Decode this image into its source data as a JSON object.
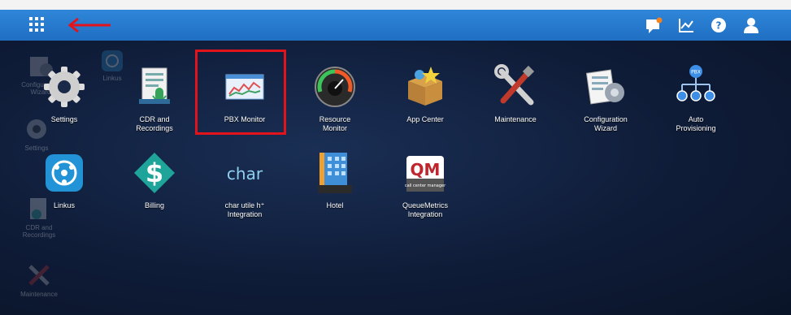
{
  "topbar": {
    "left_icon": "apps-grid-icon",
    "annotation": "red-arrow-icon",
    "right_icons": [
      "notification-icon",
      "chart-icon",
      "help-icon",
      "user-icon"
    ],
    "colors": {
      "bar": "#2377cd",
      "badge": "#f5821f"
    }
  },
  "background_items": [
    {
      "label": "Configuration\nWizard",
      "icon": "config-wizard-icon"
    },
    {
      "label": "Linkus",
      "icon": "linkus-icon"
    },
    {
      "label": "Settings",
      "icon": "gear-icon"
    },
    {
      "label": "CDR and\nRecordings",
      "icon": "cdr-icon"
    },
    {
      "label": "Maintenance",
      "icon": "tools-icon"
    }
  ],
  "apps": [
    {
      "label": "Settings",
      "icon": "gear-icon"
    },
    {
      "label": "CDR and\nRecordings",
      "icon": "cdr-icon"
    },
    {
      "label": "PBX Monitor",
      "icon": "monitor-icon"
    },
    {
      "label": "Resource\nMonitor",
      "icon": "gauge-icon"
    },
    {
      "label": "App Center",
      "icon": "box-icon"
    },
    {
      "label": "Maintenance",
      "icon": "tools-icon"
    },
    {
      "label": "Configuration\nWizard",
      "icon": "config-wizard-icon"
    },
    {
      "label": "Auto\nProvisioning",
      "icon": "provisioning-icon"
    },
    {
      "label": "Linkus",
      "icon": "linkus-icon"
    },
    {
      "label": "Billing",
      "icon": "dollar-icon"
    },
    {
      "label": "char utile h⁺\nIntegration",
      "icon": "char-logo-icon",
      "logo_text": "char"
    },
    {
      "label": "Hotel",
      "icon": "hotel-icon"
    },
    {
      "label": "QueueMetrics\nIntegration",
      "icon": "queuemetrics-icon",
      "logo_text": "QM",
      "logo_sub": "call center manager"
    }
  ],
  "highlight": {
    "target": "PBX Monitor",
    "color": "#e3131b"
  }
}
